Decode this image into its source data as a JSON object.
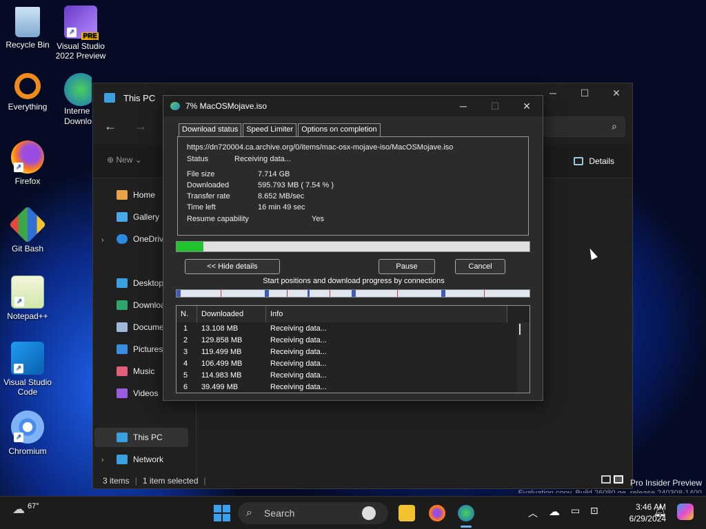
{
  "desktop": {
    "icons": [
      {
        "label": "Recycle Bin",
        "icon": "recycle-bin-icon"
      },
      {
        "label": "Visual Studio 2022 Preview",
        "icon": "visual-studio-icon",
        "badge": "PRE"
      },
      {
        "label": "Everything",
        "icon": "search-icon"
      },
      {
        "label": "Internet Download Manager",
        "icon": "idm-icon",
        "visible_text": "Interne Downlo"
      },
      {
        "label": "Firefox",
        "icon": "firefox-icon"
      },
      {
        "label": "Git Bash",
        "icon": "git-icon"
      },
      {
        "label": "Notepad++",
        "icon": "notepad-icon"
      },
      {
        "label": "Visual Studio Code",
        "icon": "vscode-icon"
      },
      {
        "label": "Chromium",
        "icon": "chromium-icon"
      }
    ]
  },
  "explorer": {
    "title": "This PC",
    "new_label": "New",
    "details_label": "Details",
    "sidebar": [
      {
        "label": "Home",
        "icon": "home-icon"
      },
      {
        "label": "Gallery",
        "icon": "gallery-icon"
      },
      {
        "label": "OneDrive",
        "icon": "onedrive-icon"
      },
      {
        "label": "Desktop",
        "icon": "desktop-icon"
      },
      {
        "label": "Downloa",
        "icon": "download-icon"
      },
      {
        "label": "Documer",
        "icon": "documents-icon"
      },
      {
        "label": "Pictures",
        "icon": "pictures-icon"
      },
      {
        "label": "Music",
        "icon": "music-icon"
      },
      {
        "label": "Videos",
        "icon": "videos-icon"
      },
      {
        "label": "This PC",
        "icon": "pc-icon"
      },
      {
        "label": "Network",
        "icon": "network-icon"
      }
    ],
    "status": {
      "items": "3 items",
      "selected": "1 item selected"
    }
  },
  "idm": {
    "title": "7% MacOSMojave.iso",
    "tabs": [
      "Download status",
      "Speed Limiter",
      "Options on completion"
    ],
    "url": "https://dn720004.ca.archive.org/0/items/mac-osx-mojave-iso/MacOSMojave.iso",
    "status_label": "Status",
    "status_value": "Receiving data...",
    "file_size_label": "File size",
    "file_size": "7.714  GB",
    "downloaded_label": "Downloaded",
    "downloaded": "595.793  MB  ( 7.54 % )",
    "rate_label": "Transfer rate",
    "rate": "8.652  MB/sec",
    "time_left_label": "Time left",
    "time_left": "16 min 49 sec",
    "resume_label": "Resume capability",
    "resume": "Yes",
    "progress": 0.0754,
    "hide_details": "<< Hide details",
    "pause": "Pause",
    "cancel": "Cancel",
    "connections_label": "Start positions and download progress by connections",
    "columns": [
      "N.",
      "Downloaded",
      "Info"
    ],
    "connections": [
      {
        "n": "1",
        "downloaded": "13.108  MB",
        "info": "Receiving data..."
      },
      {
        "n": "2",
        "downloaded": "129.858  MB",
        "info": "Receiving data..."
      },
      {
        "n": "3",
        "downloaded": "119.499  MB",
        "info": "Receiving data..."
      },
      {
        "n": "4",
        "downloaded": "106.499  MB",
        "info": "Receiving data..."
      },
      {
        "n": "5",
        "downloaded": "114.983  MB",
        "info": "Receiving data..."
      },
      {
        "n": "6",
        "downloaded": "39.499  MB",
        "info": "Receiving data..."
      }
    ]
  },
  "taskbar": {
    "weather": "67°",
    "search_placeholder": "Search",
    "time": "3:46 AM",
    "date": "6/29/2024"
  },
  "watermark": {
    "line1": "Pro Insider Preview",
    "line2": "Evaluation copy. Build 26080.ge_release.240308-1400"
  }
}
